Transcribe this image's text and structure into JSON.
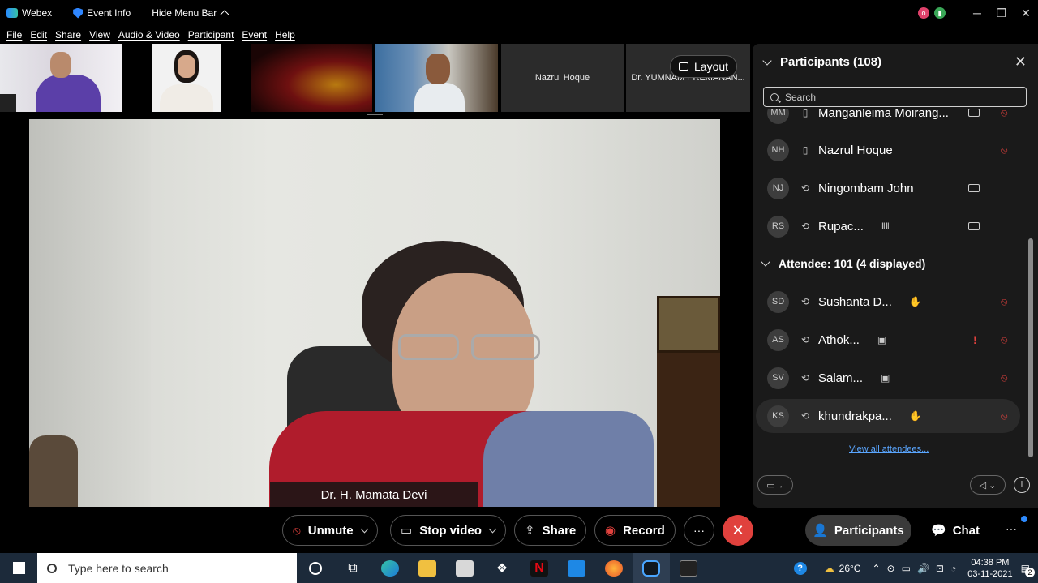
{
  "titlebar": {
    "app_name": "Webex",
    "event_info": "Event Info",
    "hide_menu": "Hide Menu Bar",
    "avatar_initial": "o"
  },
  "menu": [
    "File",
    "Edit",
    "Share",
    "View",
    "Audio & Video",
    "Participant",
    "Event",
    "Help"
  ],
  "thumbnails": {
    "t5_name": "Nazrul Hoque",
    "t6_name": "Dr. YUMNAM PREMANAN...",
    "layout_label": "Layout"
  },
  "main_video": {
    "speaker_name": "Dr. H. Mamata Devi"
  },
  "panel": {
    "title": "Participants (108)",
    "search_placeholder": "Search",
    "panelists": [
      {
        "initials": "MM",
        "name": "Manganleima Moirang...",
        "extra": ""
      },
      {
        "initials": "NH",
        "name": "Nazrul Hoque",
        "extra": ""
      },
      {
        "initials": "NJ",
        "name": "Ningombam John",
        "extra": ""
      },
      {
        "initials": "RS",
        "name": "Rupac...",
        "extra": "‖‖"
      }
    ],
    "attendee_header": "Attendee: 101 (4 displayed)",
    "attendees": [
      {
        "initials": "SD",
        "name": "Sushanta D..."
      },
      {
        "initials": "AS",
        "name": "Athok..."
      },
      {
        "initials": "SV",
        "name": "Salam..."
      },
      {
        "initials": "KS",
        "name": "khundrakpa..."
      }
    ],
    "view_all": "View all attendees..."
  },
  "controls": {
    "unmute": "Unmute",
    "stop_video": "Stop video",
    "share": "Share",
    "record": "Record",
    "more": "···",
    "participants": "Participants",
    "chat": "Chat"
  },
  "taskbar": {
    "search_placeholder": "Type here to search",
    "temperature": "26°C",
    "time": "04:38 PM",
    "date": "03-11-2021",
    "notifications": "2"
  },
  "colors": {
    "end_call": "#e0413d",
    "accent_blue": "#2e8bff",
    "panel_bg": "#1a1a1a"
  }
}
